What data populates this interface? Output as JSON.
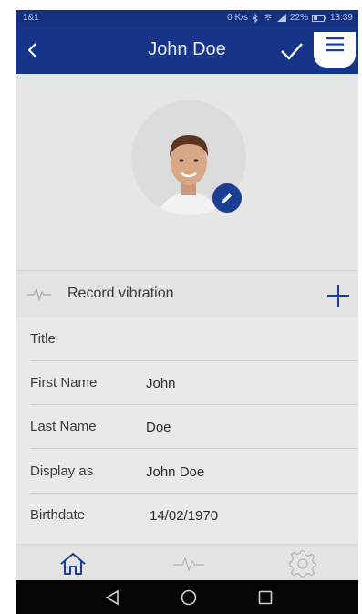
{
  "status_bar": {
    "carrier": "1&1",
    "net_speed": "0 K/s",
    "battery": "22%",
    "time": "13:39"
  },
  "app_bar": {
    "title": "John Doe",
    "back_icon": "chevron-left-icon",
    "confirm_icon": "check-icon",
    "menu_icon": "hamburger-menu-icon"
  },
  "profile": {
    "avatar_icon": "profile-photo",
    "edit_icon": "pencil-icon"
  },
  "record": {
    "label": "Record vibration",
    "icon": "pulse-icon",
    "add_icon": "plus-icon"
  },
  "fields": [
    {
      "label": "Title",
      "value": ""
    },
    {
      "label": "First Name",
      "value": "John"
    },
    {
      "label": "Last Name",
      "value": "Doe"
    },
    {
      "label": "Display as",
      "value": "John Doe"
    },
    {
      "label": "Birthdate",
      "value": "14/02/1970"
    }
  ],
  "bottom_nav": [
    "home-icon",
    "pulse-icon",
    "gear-icon"
  ],
  "system_nav": [
    "back-triangle-icon",
    "home-circle-icon",
    "recents-square-icon"
  ],
  "colors": {
    "app_bar": "#15348a",
    "accent": "#1a3f92",
    "background": "#e9e9e9"
  }
}
